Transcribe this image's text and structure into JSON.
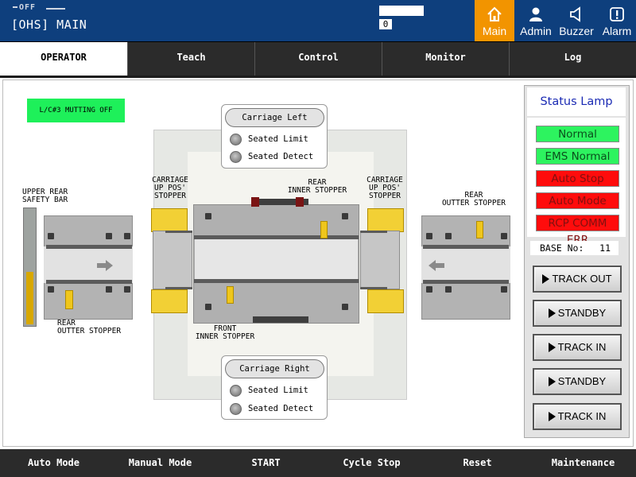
{
  "header": {
    "status_indicator": "OFF",
    "title": "[OHS] MAIN",
    "counter_value": "0",
    "nav": [
      {
        "label": "Main",
        "icon": "home-icon",
        "active": true
      },
      {
        "label": "Admin",
        "icon": "user-icon",
        "active": false
      },
      {
        "label": "Buzzer",
        "icon": "speaker-icon",
        "active": false
      },
      {
        "label": "Alarm",
        "icon": "alert-icon",
        "active": false
      }
    ]
  },
  "tabs": [
    {
      "label": "OPERATOR",
      "active": true
    },
    {
      "label": "Teach",
      "active": false
    },
    {
      "label": "Control",
      "active": false
    },
    {
      "label": "Monitor",
      "active": false
    },
    {
      "label": "Log",
      "active": false
    }
  ],
  "diagram": {
    "mutting_status": "L/C#3 MUTTING OFF",
    "carriage_left": {
      "title": "Carriage Left",
      "rows": [
        "Seated Limit",
        "Seated Detect"
      ]
    },
    "carriage_right": {
      "title": "Carriage Right",
      "rows": [
        "Seated Limit",
        "Seated Detect"
      ]
    },
    "labels": {
      "upper_rear_safety_bar": "UPPER REAR\nSAFETY BAR",
      "carriage_up_pos_stopper_left": "CARRIAGE\nUP POS'\nSTOPPER",
      "carriage_up_pos_stopper_right": "CARRIAGE\nUP POS'\nSTOPPER",
      "rear_inner_stopper": "REAR\nINNER STOPPER",
      "rear_outter_stopper_right": "REAR\nOUTTER STOPPER",
      "rear_outter_stopper_left": "REAR\nOUTTER STOPPER",
      "front_inner_stopper": "FRONT\nINNER STOPPER"
    },
    "safety_bar_level": 0.45
  },
  "status_lamp": {
    "title": "Status Lamp",
    "lamps": [
      {
        "label": "Normal",
        "state": "green"
      },
      {
        "label": "EMS Normal",
        "state": "green"
      },
      {
        "label": "Auto Stop",
        "state": "red"
      },
      {
        "label": "Auto Mode",
        "state": "red"
      },
      {
        "label": "RCP COMM ERR",
        "state": "red"
      }
    ],
    "base_label": "BASE No:",
    "base_value": "11"
  },
  "track_buttons": [
    "TRACK OUT",
    "STANDBY",
    "TRACK IN",
    "STANDBY",
    "TRACK IN"
  ],
  "footer": [
    "Auto Mode",
    "Manual Mode",
    "START",
    "Cycle Stop",
    "Reset",
    "Maintenance"
  ],
  "colors": {
    "header_bg": "#0e3f7d",
    "active_nav": "#f29400",
    "lamp_green": "#2df35f",
    "lamp_red": "#ff0c0c",
    "stopper_yellow": "#efc61c",
    "status_title_blue": "#1b2bb4"
  }
}
